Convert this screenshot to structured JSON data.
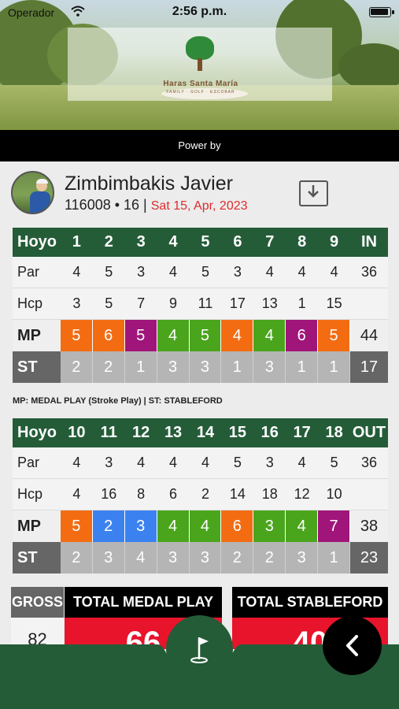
{
  "status_bar": {
    "carrier": "Operador",
    "time": "2:56 p.m."
  },
  "header": {
    "club_name": "Haras Santa María",
    "club_tagline": "FAMILY · GOLF · ESCOBAR",
    "powered_by": "Power by"
  },
  "player": {
    "name": "Zimbimbakis Javier",
    "id_handicap": "116008 • 16 |",
    "date": "Sat 15, Apr, 2023"
  },
  "front_nine": {
    "header": [
      "Hoyo",
      "1",
      "2",
      "3",
      "4",
      "5",
      "6",
      "7",
      "8",
      "9",
      "IN"
    ],
    "par": [
      "Par",
      "4",
      "5",
      "3",
      "4",
      "5",
      "3",
      "4",
      "4",
      "4",
      "36"
    ],
    "hcp": [
      "Hcp",
      "3",
      "5",
      "7",
      "9",
      "11",
      "17",
      "13",
      "1",
      "15",
      ""
    ],
    "mp": [
      "MP",
      "5",
      "6",
      "5",
      "4",
      "5",
      "4",
      "4",
      "6",
      "5",
      "44"
    ],
    "st": [
      "ST",
      "2",
      "2",
      "1",
      "3",
      "3",
      "1",
      "3",
      "1",
      "1",
      "17"
    ]
  },
  "legend": "MP: MEDAL PLAY (Stroke Play) | ST: STABLEFORD",
  "back_nine": {
    "header": [
      "Hoyo",
      "10",
      "11",
      "12",
      "13",
      "14",
      "15",
      "16",
      "17",
      "18",
      "OUT"
    ],
    "par": [
      "Par",
      "4",
      "3",
      "4",
      "4",
      "4",
      "5",
      "3",
      "4",
      "5",
      "36"
    ],
    "hcp": [
      "Hcp",
      "4",
      "16",
      "8",
      "6",
      "2",
      "14",
      "18",
      "12",
      "10",
      ""
    ],
    "mp": [
      "MP",
      "5",
      "2",
      "3",
      "4",
      "4",
      "6",
      "3",
      "4",
      "7",
      "38"
    ],
    "st": [
      "ST",
      "2",
      "3",
      "4",
      "3",
      "3",
      "2",
      "2",
      "3",
      "1",
      "23"
    ]
  },
  "colors": {
    "bogey": "#f36c12",
    "double_bogey": "#a0157a",
    "par": "#4aa51d",
    "birdie": "#3b82f0",
    "eagle": "#1a4fd8",
    "header_green": "#245c38",
    "total_red": "#e8142c"
  },
  "totals": {
    "gross_label": "GROSS",
    "gross_value": "82",
    "medal_label": "TOTAL MEDAL PLAY",
    "medal_value": "66",
    "stableford_label": "TOTAL STABLEFORD",
    "stableford_value": "40"
  },
  "nav": {
    "center_icon": "golf-flag-icon",
    "back_icon": "chevron-left-icon"
  }
}
